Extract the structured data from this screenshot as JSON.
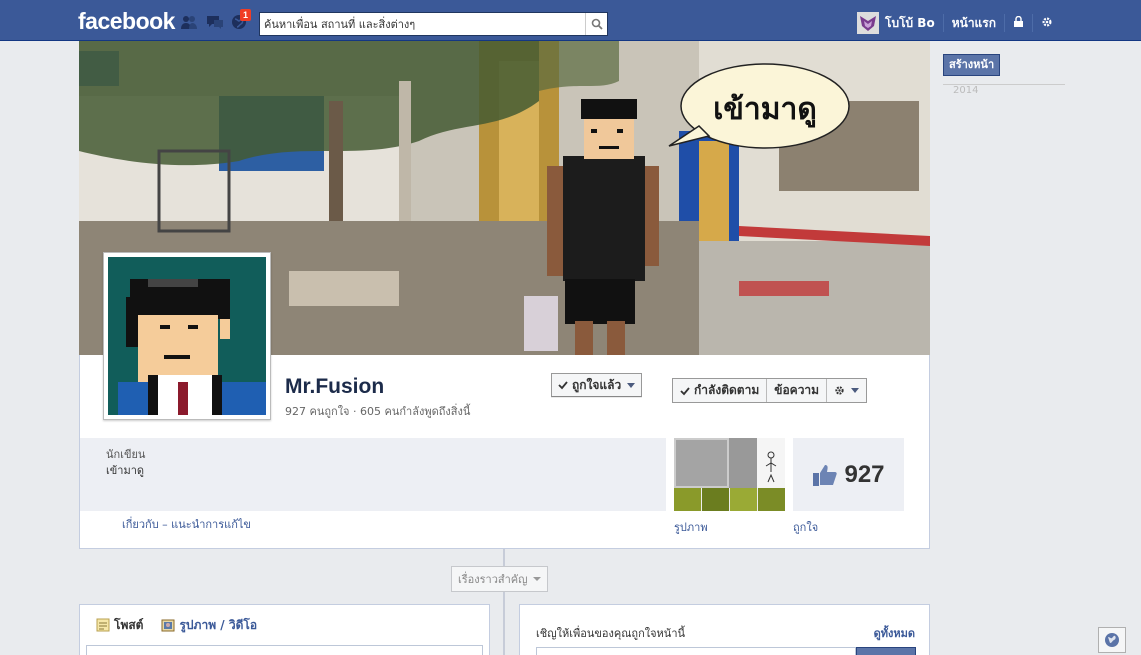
{
  "topbar": {
    "logo": "facebook",
    "notifications_count": "1",
    "search_placeholder": "ค้นหาเพื่อน สถานที่ และสิ่งต่างๆ",
    "user_name": "โบโบ้ Bo",
    "home_label": "หน้าแรก",
    "icons": [
      "friend-requests-icon",
      "messages-icon",
      "notifications-icon",
      "search-icon",
      "privacy-lock-icon",
      "settings-gear-icon"
    ]
  },
  "right_column": {
    "create_page_label": "สร้างหน้า",
    "year_label": "2014"
  },
  "cover": {
    "speech_bubble": "เข้ามาดู"
  },
  "page": {
    "name": "Mr.Fusion",
    "stats": "927 คนถูกใจ · 605 คนกำลังพูดถึงสิ่งนี้",
    "liked_button": "ถูกใจแล้ว",
    "following_button": "กำลังติดตาม",
    "message_button": "ข้อความ"
  },
  "about": {
    "category": "นักเขียน",
    "description": "เข้ามาดู",
    "links": "เกี่ยวกับ – แนะนำการแก้ไข"
  },
  "tiles": {
    "photos_label": "รูปภาพ",
    "likes_count": "927",
    "likes_label": "ถูกใจ"
  },
  "timeline": {
    "highlights_label": "เรื่องราวสำคัญ"
  },
  "composer": {
    "tab_post": "โพสต์",
    "tab_photo": "รูปภาพ / วิดีโอ"
  },
  "invite": {
    "title": "เชิญให้เพื่อนของคุณถูกใจหน้านี้",
    "see_all": "ดูทั้งหมด"
  },
  "colors": {
    "brand_blue": "#3b5998",
    "link_blue": "#3b5998",
    "page_bg": "#e9ebee"
  }
}
